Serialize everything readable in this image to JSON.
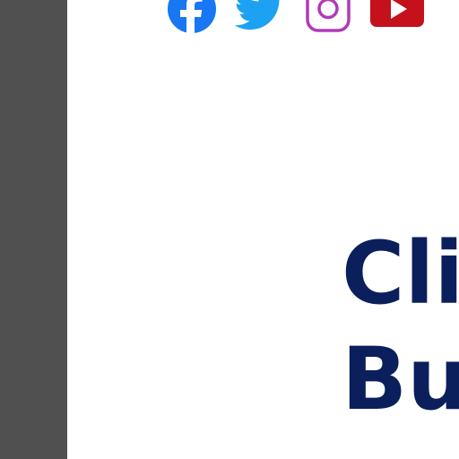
{
  "social": {
    "items": [
      {
        "icon": "facebook-icon",
        "color": "#1877f2"
      },
      {
        "icon": "twitter-icon",
        "color": "#1da1f2"
      },
      {
        "icon": "instagram-icon",
        "color": "#b03ab8"
      },
      {
        "icon": "youtube-icon",
        "color": "#c4111b"
      }
    ]
  },
  "heading": {
    "line1": "Cli",
    "line2": "Bu"
  },
  "colors": {
    "sidebar": "#505050",
    "heading": "#0b1f5c",
    "background": "#ffffff"
  }
}
